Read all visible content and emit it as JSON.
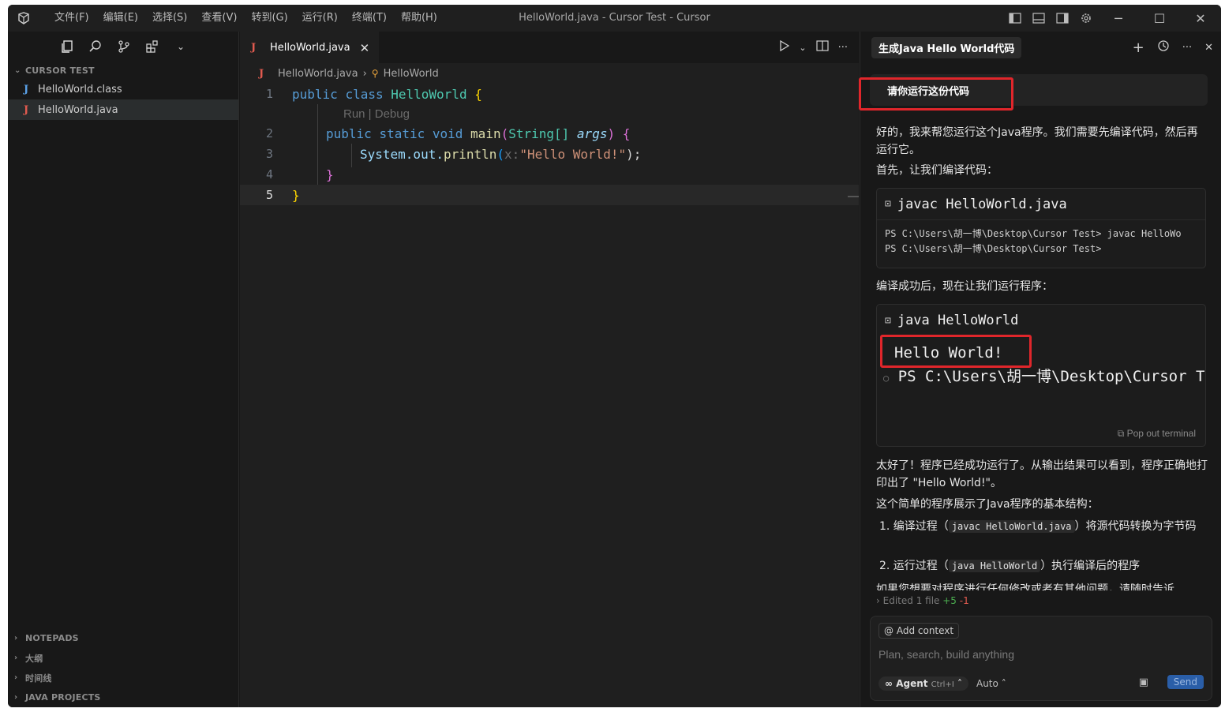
{
  "window": {
    "title": "HelloWorld.java - Cursor Test - Cursor",
    "menu": [
      "文件(F)",
      "编辑(E)",
      "选择(S)",
      "查看(V)",
      "转到(G)",
      "运行(R)",
      "终端(T)",
      "帮助(H)"
    ]
  },
  "sidebar": {
    "section_title": "CURSOR TEST",
    "files": [
      {
        "name": "HelloWorld.class",
        "icon": "J"
      },
      {
        "name": "HelloWorld.java",
        "icon": "J"
      }
    ],
    "bottom_sections": [
      "NOTEPADS",
      "大纲",
      "时间线",
      "JAVA PROJECTS"
    ]
  },
  "editor": {
    "tab_label": "HelloWorld.java",
    "breadcrumb_file": "HelloWorld.java",
    "breadcrumb_symbol": "HelloWorld",
    "codelens": "Run | Debug",
    "line_numbers": [
      "1",
      "2",
      "3",
      "4",
      "5"
    ],
    "code": {
      "l1_kw1": "public",
      "l1_kw2": "class",
      "l1_cls": "HelloWorld",
      "l1_brace": "{",
      "l2_kw1": "public",
      "l2_kw2": "static",
      "l2_kw3": "void",
      "l2_fn": "main",
      "l2_open": "(",
      "l2_type": "String[]",
      "l2_param": "args",
      "l2_close": ")",
      "l2_brace": "{",
      "l3_sys": "System.out.",
      "l3_fn": "println",
      "l3_open": "(",
      "l3_hint": "x:",
      "l3_str": "\"Hello World!\"",
      "l3_close": ");",
      "l4_brace": "}",
      "l5_brace": "}"
    }
  },
  "chat": {
    "tab_title": "生成Java Hello World代码",
    "user_message": "请你运行这份代码",
    "reply_1": "好的，我来帮您运行这个Java程序。我们需要先编译代码，然后再运行它。",
    "reply_2": "首先，让我们编译代码：",
    "cmd1": {
      "command": "javac HelloWorld.java",
      "output_1": "PS C:\\Users\\胡一博\\Desktop\\Cursor Test> javac HelloWo",
      "output_2": "PS C:\\Users\\胡一博\\Desktop\\Cursor Test>"
    },
    "reply_3": "编译成功后，现在让我们运行程序：",
    "cmd2": {
      "command": "java HelloWorld",
      "output_1": "Hello World!",
      "output_2": "PS C:\\Users\\胡一博\\Desktop\\Cursor Te",
      "popout": "Pop out terminal"
    },
    "reply_4": "太好了！程序已经成功运行了。从输出结果可以看到，程序正确地打印出了 \"Hello World!\"。",
    "reply_5": "这个简单的程序展示了Java程序的基本结构：",
    "list_1_pre": "1. 编译过程（",
    "list_1_code": "javac HelloWorld.java",
    "list_1_post": "）将源代码转换为字节码",
    "list_2_pre": "2. 运行过程（",
    "list_2_code": "java HelloWorld",
    "list_2_post": "）执行编译后的程序",
    "reply_6_partial": "如果您想要对程序进行任何修改或者有其他问题，请随时告诉",
    "edited_label": "Edited 1 file",
    "edited_plus": "+5",
    "edited_minus": "-1",
    "composer": {
      "add_context": "Add context",
      "placeholder": "Plan, search, build anything",
      "agent_label": "Agent",
      "agent_shortcut": "Ctrl+I",
      "model": "Auto",
      "send": "Send"
    }
  },
  "colors": {
    "highlight_box": "#e0262b",
    "java_icon": "#e05a4f"
  }
}
